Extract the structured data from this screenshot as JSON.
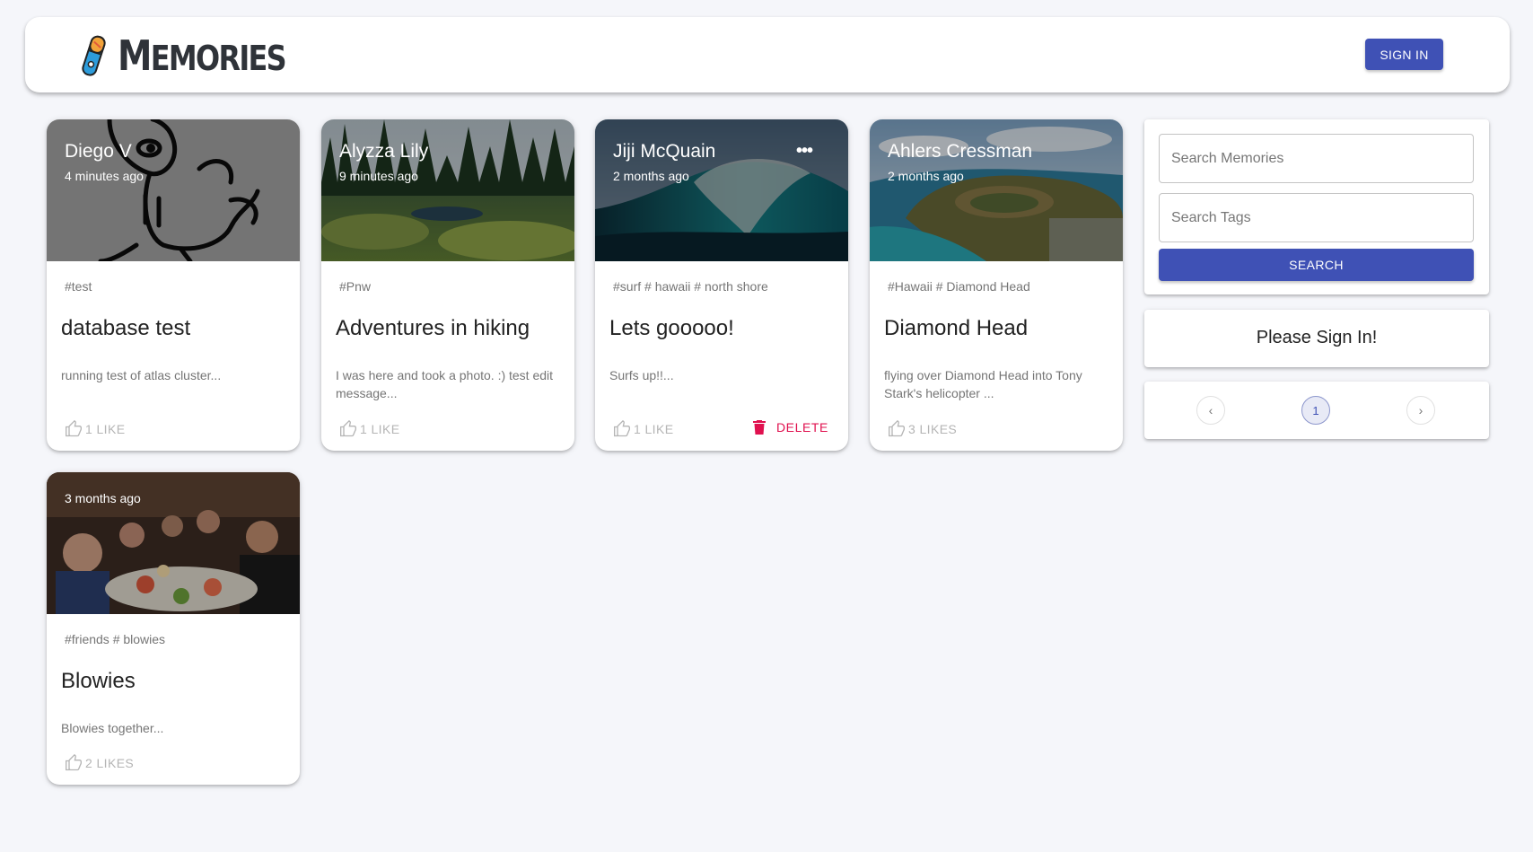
{
  "header": {
    "brand_first": "M",
    "brand_rest": "EMORIES",
    "signin_label": "SIGN IN"
  },
  "posts": [
    {
      "creator": "Diego V",
      "time_ago": "4 minutes ago",
      "tags": "#test",
      "title": "database test",
      "message": "running test of atlas cluster...",
      "likes": "1 LIKE"
    },
    {
      "creator": "Alyzza Lily",
      "time_ago": "9 minutes ago",
      "tags": "#Pnw",
      "title": "Adventures in hiking",
      "message": "I was here and took a photo. :) test edit message...",
      "likes": "1 LIKE"
    },
    {
      "creator": "Jiji McQuain",
      "time_ago": "2 months ago",
      "tags": "#surf # hawaii # north shore",
      "title": "Lets gooooo!",
      "message": "Surfs up!!...",
      "likes": "1 LIKE",
      "more_glyph": "•••",
      "delete_label": "DELETE"
    },
    {
      "creator": "Ahlers Cressman",
      "time_ago": "2 months ago",
      "tags": "#Hawaii # Diamond Head",
      "title": "Diamond Head",
      "message": "flying over Diamond Head into Tony Stark's helicopter ...",
      "likes": "3 LIKES"
    },
    {
      "creator": "",
      "time_ago": "3 months ago",
      "tags": "#friends # blowies",
      "title": "Blowies",
      "message": "Blowies together...",
      "likes": "2 LIKES"
    }
  ],
  "sidebar": {
    "search_memories_placeholder": "Search Memories",
    "search_tags_placeholder": "Search Tags",
    "search_label": "SEARCH",
    "signin_message": "Please Sign In!",
    "pagination": {
      "prev_glyph": "‹",
      "current_page": "1",
      "next_glyph": "›"
    }
  },
  "colors": {
    "primary": "#3f51b5",
    "delete": "#e0114f",
    "background": "#f5f6fa"
  }
}
